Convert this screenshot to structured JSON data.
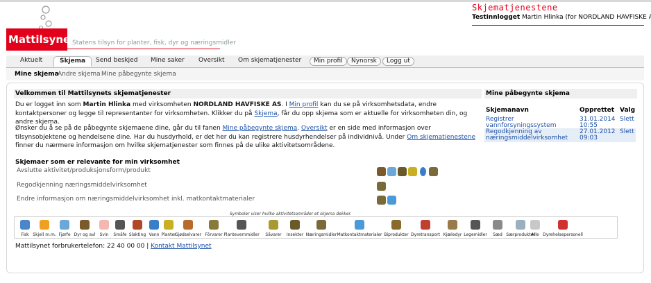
{
  "header": {
    "brand": "Mattilsynet",
    "tagline": "Statens tilsyn for planter, fisk, dyr og næringsmidler",
    "app_title": "Skjematjenestene",
    "login_prefix": "Testinnlogget",
    "user_name": "Martin Hlinka",
    "user_org": "(for NORDLAND HAVFISKE AS)"
  },
  "nav": {
    "tabs": [
      "Aktuelt",
      "Skjema",
      "Send beskjed",
      "Mine saker",
      "Oversikt",
      "Om skjematjenester"
    ],
    "active_tab": "Skjema",
    "pills": [
      "Min profil",
      "Nynorsk",
      "Logg ut"
    ],
    "subtabs": [
      "Mine skjema",
      "Andre skjema",
      "Mine påbegynte skjema"
    ],
    "active_subtab": "Mine skjema"
  },
  "main": {
    "heading": "Velkommen til Mattilsynets skjematjenester",
    "p1": {
      "t1": "Du er logget inn som ",
      "user": "Martin Hlinka",
      "t2": " med virksomheten ",
      "org": "NORDLAND HAVFISKE AS",
      "t3": ". I ",
      "link1": "Min profil",
      "t4": " kan du se på virksomhetsdata, endre kontaktpersoner og legge til representanter for virksomheten. Klikker du på ",
      "link2": "Skjema",
      "t5": ", får du opp skjema som er aktuelle for virksomheten din, og andre skjema."
    },
    "p2": {
      "t1": "Ønsker du å se på de påbegynte skjemaene dine, går du til fanen ",
      "link1": "Mine påbegynte skjema",
      "t2": ". ",
      "link2": "Oversikt",
      "t3": " er en side med informasjon over tilsynsobjektene og hendelsene dine. Har du husdyrhold, er det her du kan registrere husdyrhendelser på individnivå. Under ",
      "link3": "Om skjematjenestene",
      "t4": " finner du nærmere informasjon om hvilke skjematjenester som finnes på de ulike aktivitetsområdene."
    },
    "relevant_heading": "Skjemaer som er relevante for min virksomhet",
    "relevant_forms": [
      {
        "label": "Avslutte aktivitet/produksjonsform/produkt",
        "icons": [
          "cattle-icon",
          "poultry-icon",
          "bee-icon",
          "plant-icon",
          "water-icon",
          "food-jar-icon"
        ]
      },
      {
        "label": "Regodkjenning næringsmiddelvirksomhet",
        "icons": [
          "food-jar-icon"
        ]
      },
      {
        "label": "Endre informasjon om næringsmiddelvirksomhet inkl. matkontaktmaterialer",
        "icons": [
          "food-jar-icon",
          "food-contact-icon"
        ]
      }
    ],
    "legend_note": "Symboler viser hvilke aktivitetsområder et skjema dekker.",
    "legend": [
      {
        "label": "Fisk",
        "icon": "fish-icon",
        "color": "#4a86c8"
      },
      {
        "label": "Skjell m.m.",
        "icon": "shell-icon",
        "color": "#f0a020"
      },
      {
        "label": "Fjørfe",
        "icon": "poultry-icon",
        "color": "#6aa8d8"
      },
      {
        "label": "Dyr og avl",
        "icon": "cattle-icon",
        "color": "#7a5a2a"
      },
      {
        "label": "Svin",
        "icon": "pig-icon",
        "color": "#f4b8b0"
      },
      {
        "label": "Småfe",
        "icon": "sheep-icon",
        "color": "#555555"
      },
      {
        "label": "Slakting",
        "icon": "meat-icon",
        "color": "#b04828"
      },
      {
        "label": "Vann",
        "icon": "water-icon",
        "color": "#3a7ec8"
      },
      {
        "label": "Planter",
        "icon": "plant-icon",
        "color": "#c8b020"
      },
      {
        "label": "Gjødselvarer",
        "icon": "fertilizer-icon",
        "color": "#b86a2a"
      },
      {
        "label": "Fôrvarer",
        "icon": "feed-icon",
        "color": "#8a7a3a"
      },
      {
        "label": "Plantevernmidler",
        "icon": "pesticide-icon",
        "color": "#555555"
      },
      {
        "label": "Såvarer",
        "icon": "seed-icon",
        "color": "#a89a30"
      },
      {
        "label": "Insekter",
        "icon": "insect-icon",
        "color": "#6a5a2a"
      },
      {
        "label": "Næringsmidler",
        "icon": "food-jar-icon",
        "color": "#7a6a3a"
      },
      {
        "label": "Matkontaktmaterialer",
        "icon": "food-contact-icon",
        "color": "#4a9ad8"
      },
      {
        "label": "Biprodukter",
        "icon": "byproduct-icon",
        "color": "#8a6a2a"
      },
      {
        "label": "Dyretransport",
        "icon": "truck-icon",
        "color": "#c04030"
      },
      {
        "label": "Kjæledyr",
        "icon": "pet-icon",
        "color": "#9a7a4a"
      },
      {
        "label": "Legemidler",
        "icon": "medicine-icon",
        "color": "#555555"
      },
      {
        "label": "Sæd",
        "icon": "semen-icon",
        "color": "#8a8a8a"
      },
      {
        "label": "Særprodukter",
        "icon": "special-product-icon",
        "color": "#9ab0c0"
      },
      {
        "label": "Alle",
        "icon": "all-icon",
        "color": "#c8c8c8"
      },
      {
        "label": "Dyrehelsepersonell",
        "icon": "vet-icon",
        "color": "#d03030"
      }
    ],
    "footer_text": "Mattilsynet forbrukertelefon: 22 40 00 00 |",
    "footer_link": "Kontakt Mattilsynet"
  },
  "sidebar": {
    "heading": "Mine påbegynte skjema",
    "columns": [
      "Skjemanavn",
      "Opprettet",
      "Valg"
    ],
    "rows": [
      {
        "name_line1": "Registrer",
        "name_line2": "vannforsyningssystem",
        "date": "31.01.2014",
        "time": "10:55",
        "action": "Slett"
      },
      {
        "name_line1": "Regodkjenning av",
        "name_line2": "næringsmiddelvirksomhet",
        "date": "27.01.2012",
        "time": "09:03",
        "action": "Slett"
      }
    ]
  },
  "colors": {
    "brand_red": "#e2001a",
    "link": "#1a4fa8",
    "row_highlight": "#e5edf7"
  }
}
